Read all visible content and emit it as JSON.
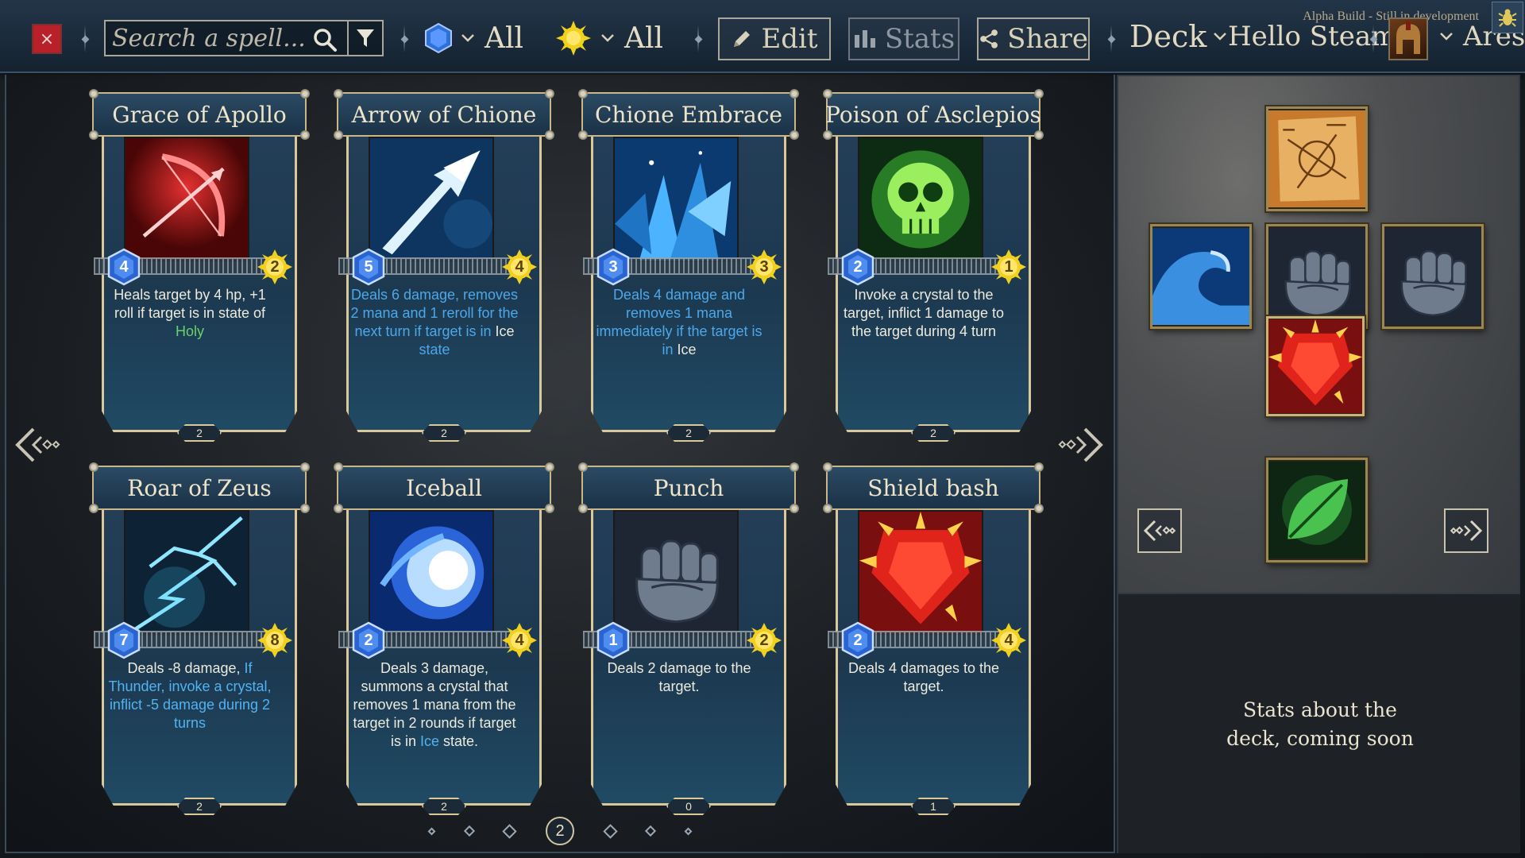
{
  "topbar": {
    "alpha_note": "Alpha Build - Still in development",
    "close_label": "×",
    "search_placeholder": "Search a spell...",
    "mana_filter_value": "All",
    "cost_filter_value": "All",
    "edit_label": "Edit",
    "stats_label": "Stats",
    "share_label": "Share",
    "deck_label": "Deck",
    "deck_name": "Hello Steam",
    "user_name": "Ares"
  },
  "cards": [
    {
      "title": "Grace of Apollo",
      "mana": "4",
      "cost": "2",
      "copies": "2",
      "art": "bow-arrow-icon",
      "style": "normal",
      "desc": [
        {
          "t": "Heals target by 4 hp, +1 roll if target is in state of "
        },
        {
          "t": "Holy",
          "c": "kw-holy"
        }
      ]
    },
    {
      "title": "Arrow of Chione",
      "mana": "5",
      "cost": "4",
      "copies": "2",
      "art": "ice-arrow-icon",
      "style": "bluish",
      "desc": [
        {
          "t": "Deals 6 damage, removes 2 mana and 1 reroll for the next turn if target is in "
        },
        {
          "t": "Ice",
          "c": "kw-ice"
        },
        {
          "t": " state"
        }
      ]
    },
    {
      "title": "Chione Embrace",
      "mana": "3",
      "cost": "3",
      "copies": "2",
      "art": "ice-crystals-icon",
      "style": "bluish",
      "desc": [
        {
          "t": "Deals 4 damage and removes 1 mana immediately if the target is in "
        },
        {
          "t": "Ice",
          "c": "kw-ice"
        }
      ]
    },
    {
      "title": "Poison of Asclepios",
      "mana": "2",
      "cost": "1",
      "copies": "2",
      "art": "poison-skull-icon",
      "style": "normal",
      "desc": [
        {
          "t": "Invoke a crystal to the target, inflict 1 damage to the target during 4 turn"
        }
      ]
    },
    {
      "title": "Roar of Zeus",
      "mana": "7",
      "cost": "8",
      "copies": "2",
      "art": "lightning-icon",
      "style": "normal",
      "desc": [
        {
          "t": "Deals -8 damage, "
        },
        {
          "t": "If Thunder, invoke a crystal, inflict -5 damage during 2 turns",
          "c": "kw-thunder"
        }
      ]
    },
    {
      "title": "Iceball",
      "mana": "2",
      "cost": "4",
      "copies": "2",
      "art": "iceball-icon",
      "style": "normal",
      "desc": [
        {
          "t": "Deals 3 damage, summons a crystal that removes 1 mana from the target in 2 rounds if target is in "
        },
        {
          "t": "Ice",
          "c": "kw-ice"
        },
        {
          "t": " state."
        }
      ]
    },
    {
      "title": "Punch",
      "mana": "1",
      "cost": "2",
      "copies": "0",
      "art": "fist-icon",
      "style": "normal",
      "desc": [
        {
          "t": "Deals 2 damage to the target."
        }
      ]
    },
    {
      "title": "Shield bash",
      "mana": "2",
      "cost": "4",
      "copies": "1",
      "art": "shield-bash-icon",
      "style": "normal",
      "desc": [
        {
          "t": "Deals 4 damages to the target."
        }
      ]
    }
  ],
  "pager": {
    "current": "2"
  },
  "deck_slots": [
    {
      "name": "deck-slot-map",
      "icon": "map-icon"
    },
    {
      "name": "deck-slot-wave",
      "icon": "wave-icon"
    },
    {
      "name": "deck-slot-fist-1",
      "icon": "fist-icon"
    },
    {
      "name": "deck-slot-fist-2",
      "icon": "fist-icon"
    },
    {
      "name": "deck-slot-shield-bash",
      "icon": "shield-bash-icon"
    },
    {
      "name": "deck-slot-leaf",
      "icon": "leaf-icon"
    }
  ],
  "stats_panel": {
    "line1": "Stats about the",
    "line2": "deck, coming soon"
  },
  "colors": {
    "holy": "#69d26a",
    "ice": "#52b2f2",
    "close": "#b8202a",
    "gold_frame": "#d9c99a"
  }
}
